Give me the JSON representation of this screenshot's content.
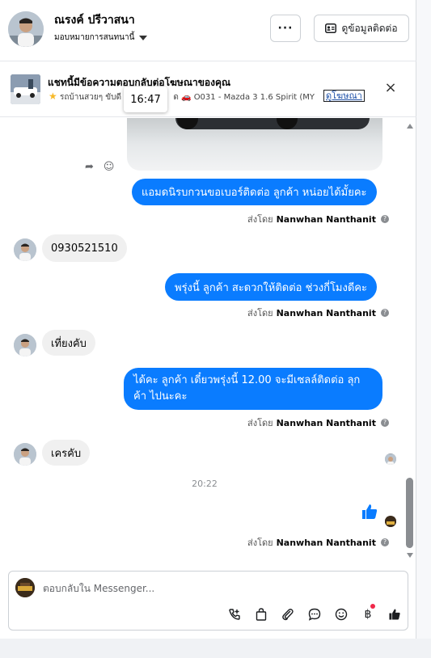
{
  "header": {
    "name": "ณรงค์ ปรีวาสนา",
    "assign_label": "มอบหมายการสนทนานี้",
    "more_label": "···",
    "contact_button": "ดูข้อมูลติดต่อ"
  },
  "ad_banner": {
    "title": "แชทนี้มีข้อความตอบกลับต่อโฆษณาของคุณ",
    "line_prefix": "รถบ้านสวยๆ ขับดี",
    "line_mid": "ด",
    "line_suffix": "O031 - Mazda 3 1.6 Spirit (MY1...",
    "link": "ดูโฆษณา",
    "close": "×"
  },
  "tooltip": {
    "time": "16:47"
  },
  "messages": [
    {
      "dir": "out",
      "text": "แอมดนิรบกวนขอเบอร์ติดต่อ ลูกค้า หน่อยได้มั้ยคะ",
      "sent_prefix": "ส่งโดย",
      "sent_by": "Nanwhan Nanthanit"
    },
    {
      "dir": "in",
      "text": "0930521510"
    },
    {
      "dir": "out",
      "text": "พรุ่งนี้ ลูกค้า สะดวกให้ติดต่อ ช่วงกี่โมงดีคะ",
      "sent_prefix": "ส่งโดย",
      "sent_by": "Nanwhan Nanthanit"
    },
    {
      "dir": "in",
      "text": "เที่ยงคับ"
    },
    {
      "dir": "out",
      "text_line1": "ได้คะ  ลูกค้า เดี๋ยวพรุ่งนี้ 12.00 จะมีเซลล์ติดต่อ ลุก",
      "text_line2": "ค้า ไปนะคะ",
      "sent_prefix": "ส่งโดย",
      "sent_by": "Nanwhan Nanthanit"
    },
    {
      "dir": "in",
      "text": "เครคับ"
    },
    {
      "dir": "out",
      "type": "like",
      "sent_prefix": "ส่งโดย",
      "sent_by": "Nanwhan Nanthanit"
    }
  ],
  "time_separator": "20:22",
  "composer": {
    "placeholder": "ตอบกลับใน Messenger...",
    "tools": [
      "call-add-icon",
      "shopping-bag-icon",
      "paperclip-icon",
      "chat-bubble-icon",
      "emoji-icon",
      "baht-icon",
      "thumbs-up-icon"
    ]
  },
  "colors": {
    "accent": "#0a7cff",
    "incoming_bg": "#f0f0f0",
    "link": "#1b4fa8"
  }
}
